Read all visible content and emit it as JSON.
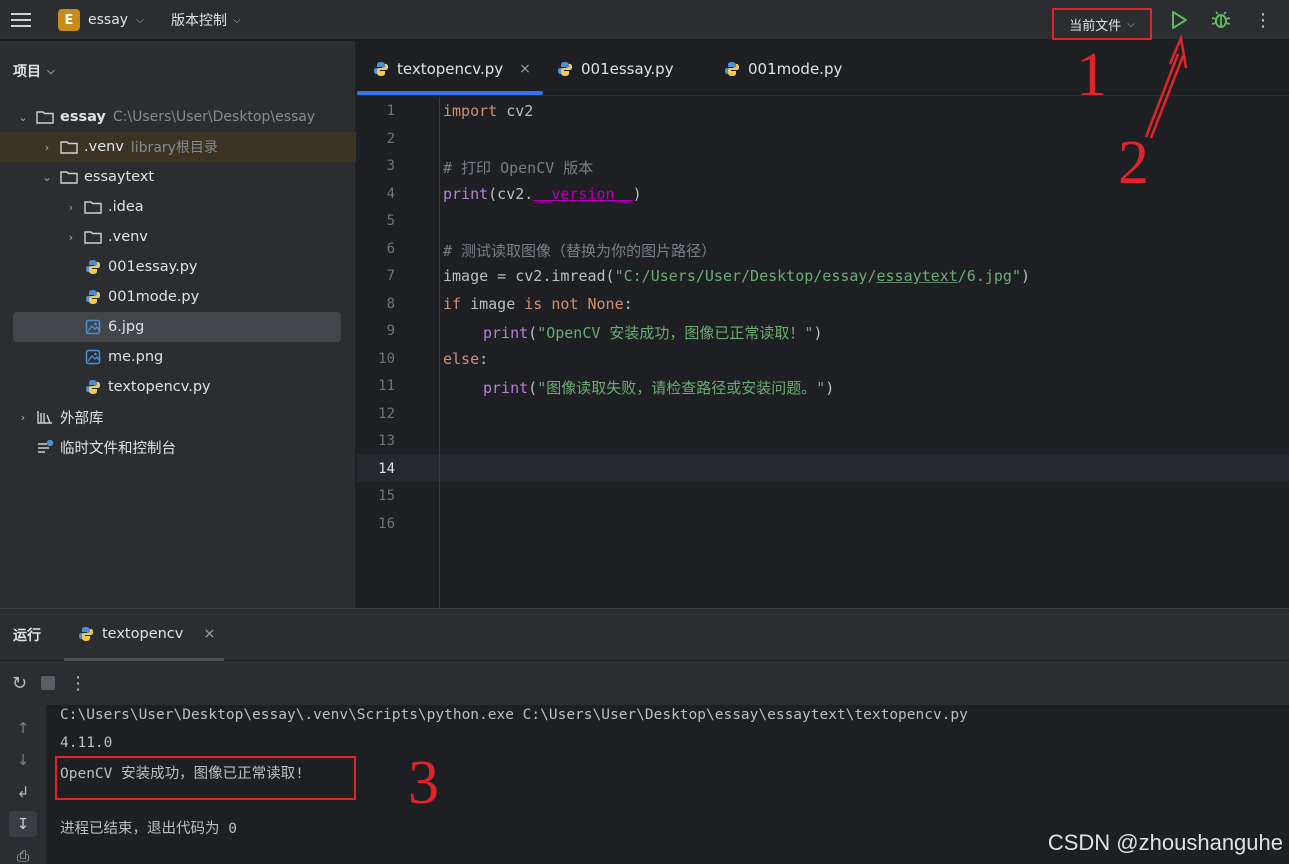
{
  "toolbar": {
    "project_badge": "E",
    "project_name": "essay",
    "vcs_label": "版本控制",
    "run_config_label": "当前文件",
    "menu_icon": "hamburger-menu-icon",
    "run_icon": "play-icon",
    "debug_icon": "bug-icon",
    "more_icon": "more-vertical-icon"
  },
  "sidebar": {
    "title": "项目",
    "tree": [
      {
        "label": "essay",
        "hint": "C:\\Users\\User\\Desktop\\essay",
        "type": "folder",
        "expanded": true
      },
      {
        "label": ".venv",
        "hint": "library根目录",
        "type": "folder",
        "expanded": false
      },
      {
        "label": "essaytext",
        "hint": "",
        "type": "folder",
        "expanded": true
      },
      {
        "label": ".idea",
        "hint": "",
        "type": "folder",
        "expanded": false
      },
      {
        "label": ".venv",
        "hint": "",
        "type": "folder",
        "expanded": false
      },
      {
        "label": "001essay.py",
        "hint": "",
        "type": "python"
      },
      {
        "label": "001mode.py",
        "hint": "",
        "type": "python"
      },
      {
        "label": "6.jpg",
        "hint": "",
        "type": "image",
        "selected": true
      },
      {
        "label": "me.png",
        "hint": "",
        "type": "image"
      },
      {
        "label": "textopencv.py",
        "hint": "",
        "type": "python"
      },
      {
        "label": "外部库",
        "hint": "",
        "type": "library"
      },
      {
        "label": "临时文件和控制台",
        "hint": "",
        "type": "scratch"
      }
    ]
  },
  "editor": {
    "tabs": [
      {
        "label": "textopencv.py",
        "active": true,
        "close": "×"
      },
      {
        "label": "001essay.py",
        "active": false
      },
      {
        "label": "001mode.py",
        "active": false
      }
    ],
    "line_numbers": [
      "1",
      "2",
      "3",
      "4",
      "5",
      "6",
      "7",
      "8",
      "9",
      "10",
      "11",
      "12",
      "13",
      "14",
      "15",
      "16"
    ],
    "current_line": "14",
    "code": {
      "l1_kw": "import",
      "l1_rest": " cv2",
      "l3": "# 打印 OpenCV 版本",
      "l4_fn": "print",
      "l4_a": "(cv2.",
      "l4_dund": "__version__",
      "l4_b": ")",
      "l6": "# 测试读取图像（替换为你的图片路径）",
      "l7_a": "image = cv2.imread(",
      "l7_str1": "\"C:/Users/User/Desktop/essay/",
      "l7_str2": "essaytext",
      "l7_str3": "/6.jpg\"",
      "l7_b": ")",
      "l8_kw1": "if",
      "l8_a": " image ",
      "l8_kw2": "is not None",
      "l8_b": ":",
      "l9_fn": "print",
      "l9_a": "(",
      "l9_str": "\"OpenCV 安装成功，图像已正常读取！\"",
      "l9_b": ")",
      "l10_kw": "else",
      "l10_b": ":",
      "l11_fn": "print",
      "l11_a": "(",
      "l11_str": "\"图像读取失败，请检查路径或安装问题。\"",
      "l11_b": ")"
    }
  },
  "run_panel": {
    "title": "运行",
    "tab_label": "textopencv",
    "tab_close": "×",
    "console": [
      "C:\\Users\\User\\Desktop\\essay\\.venv\\Scripts\\python.exe C:\\Users\\User\\Desktop\\essay\\essaytext\\textopencv.py",
      "4.11.0",
      "OpenCV 安装成功，图像已正常读取!",
      "进程已结束，退出代码为 0"
    ]
  },
  "annotations": {
    "n1": "1",
    "n2": "2",
    "n3": "3",
    "color": "#e0242b"
  },
  "watermark": "CSDN @zhoushanguhe",
  "colors": {
    "accent": "#3574f0",
    "run_green": "#5fb865",
    "keyword": "#cf8e6d",
    "string": "#6aab73",
    "comment": "#7a7e85",
    "function": "#b47fd4"
  }
}
